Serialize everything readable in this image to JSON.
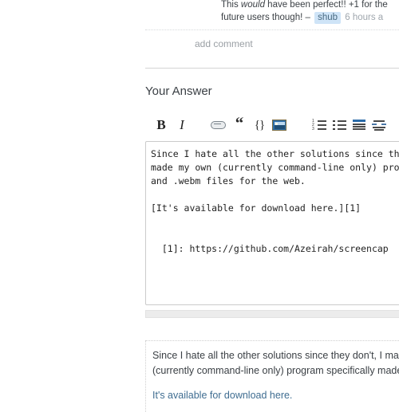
{
  "comment": {
    "line1_pre": "This ",
    "line1_em": "would",
    "line1_post": " have been perfect!! +1 for the",
    "line2": "future users though! –",
    "user": "shub",
    "time": "6 hours a",
    "add_comment_label": "add comment"
  },
  "answer_section": {
    "title": "Your Answer"
  },
  "toolbar": {
    "bold_label": "B",
    "italic_label": "I",
    "quote_label": "“",
    "code_label": "{}",
    "icons": [
      "bold-icon",
      "italic-icon",
      "hyperlink-icon",
      "blockquote-icon",
      "code-icon",
      "image-icon",
      "numbered-list-icon",
      "bulleted-list-icon",
      "horizontal-rule-icon",
      "undo-icon"
    ],
    "ol_numbers": [
      "1",
      "2",
      "3"
    ]
  },
  "editor": {
    "content": "Since I hate all the other solutions since they don't, I\nmade my own (currently command-line only) program that\nand .webm files for the web.\n\n[It's available for download here.][1]\n\n\n  [1]: https://github.com/Azeirah/screencap"
  },
  "preview": {
    "paragraph1": "Since I hate all the other solutions since they don't, I made my own\n(currently command-line only) program specifically made to record .gif",
    "paragraph1_line1": "Since I hate all the other solutions since they don't, I made my own",
    "paragraph1_line2": "(currently command-line only) program specifically made to record .gif",
    "link_text": "It's available for download here."
  },
  "colors": {
    "text": "#3b4045",
    "muted": "#9a9fa4",
    "link": "#3f6d91",
    "user_chip_bg": "#cfe4f7",
    "border": "#cbcbcb",
    "grip_bg": "#ececec"
  }
}
